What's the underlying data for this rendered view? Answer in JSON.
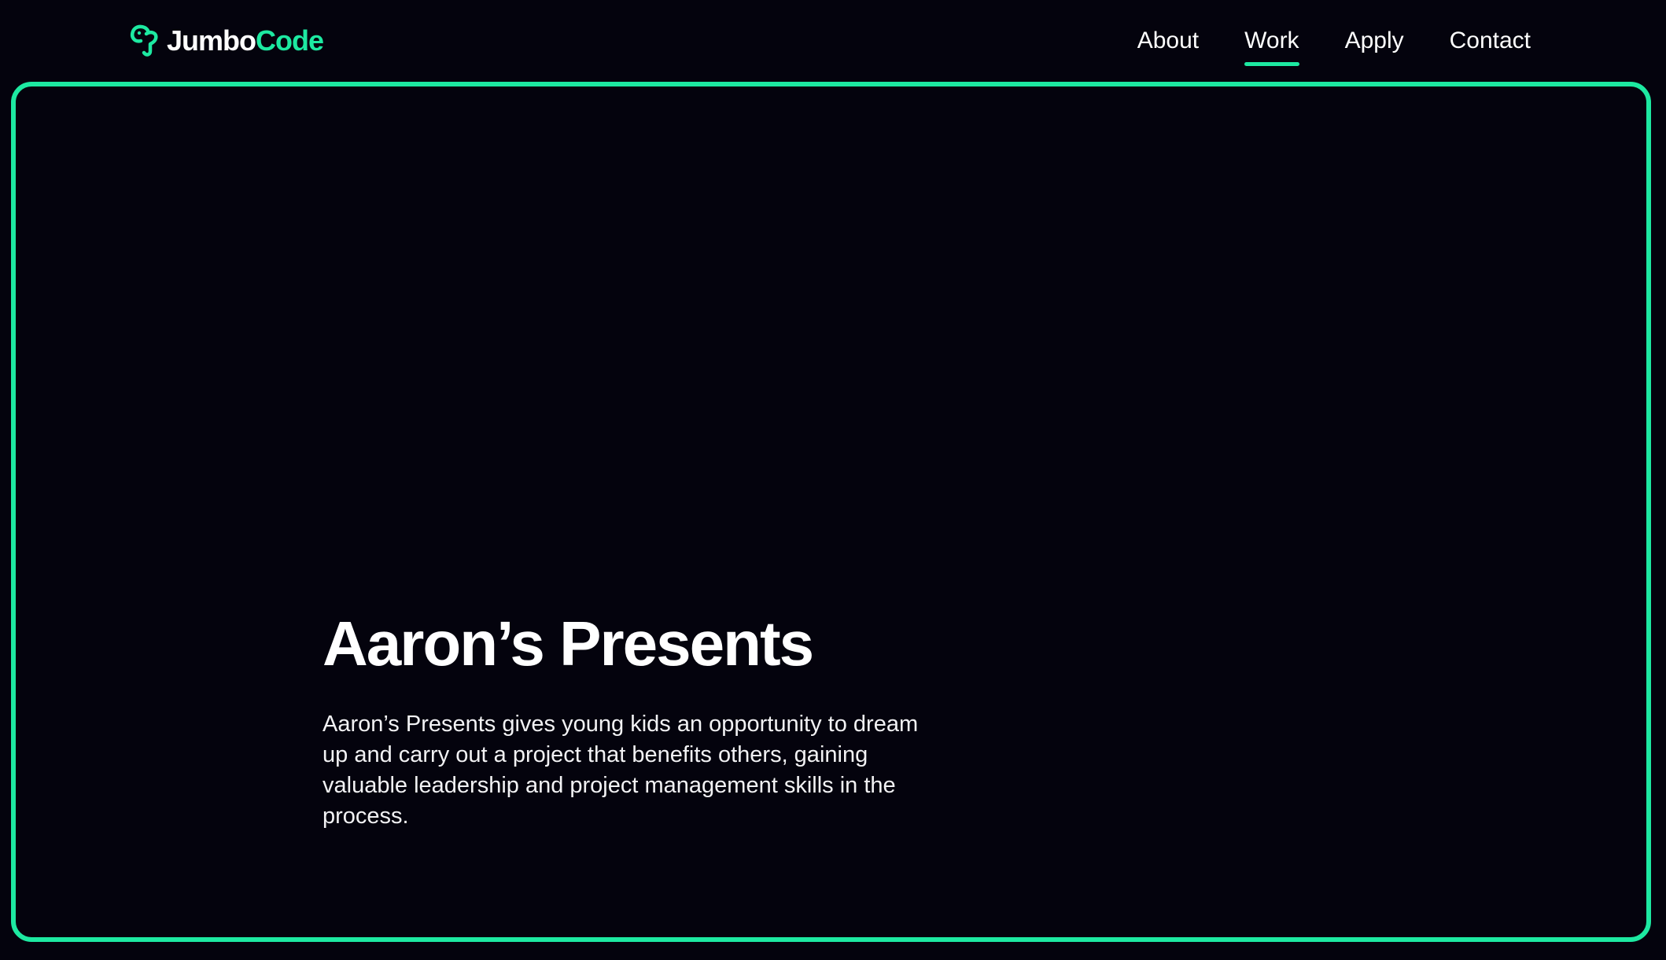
{
  "brand": {
    "name_part1": "Jumbo",
    "name_part2": "Code",
    "icon": "jumbocode-logo-icon",
    "accent_color": "#1de9a1"
  },
  "nav": {
    "items": [
      {
        "label": "About",
        "active": false
      },
      {
        "label": "Work",
        "active": true
      },
      {
        "label": "Apply",
        "active": false
      },
      {
        "label": "Contact",
        "active": false
      }
    ]
  },
  "hero": {
    "title": "Aaron’s Presents",
    "description": "Aaron’s Presents gives young kids an opportunity to dream up and carry out a project that benefits others, gaining valuable leadership and project management skills in the process."
  },
  "colors": {
    "background": "#04030d",
    "accent": "#1de9a1",
    "text": "#ffffff"
  }
}
